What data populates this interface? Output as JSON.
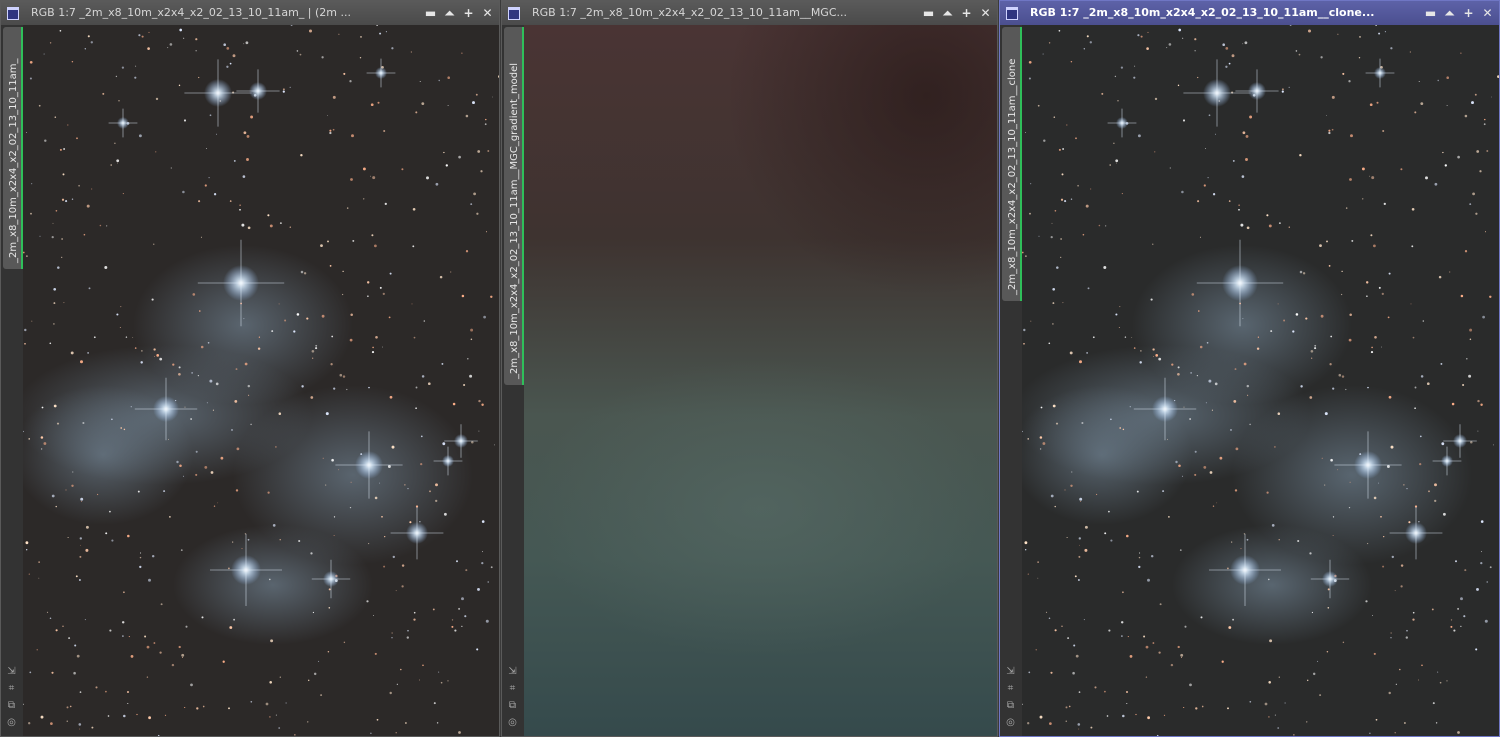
{
  "windows": [
    {
      "id": "original",
      "title": "RGB 1:7 _2m_x8_10m_x2x4_x2_02_13_10_11am_ | (2m ...",
      "tab_label": "_2m_x8_10m_x2x4_x2_02_13_10_11am_",
      "active": false,
      "image_kind": "starfield",
      "background_tint": "#2c2928"
    },
    {
      "id": "gradient-model",
      "title": "RGB 1:7 _2m_x8_10m_x2x4_x2_02_13_10_11am__MGC...",
      "tab_label": "_2m_x8_10m_x2x4_x2_02_13_10_11am__MGC_gradient_model",
      "active": false,
      "image_kind": "gradient",
      "gradient_colors": [
        "#4a3434",
        "#3e3330",
        "#4a5650",
        "#455854",
        "#354a4c"
      ]
    },
    {
      "id": "clone",
      "title": "RGB 1:7 _2m_x8_10m_x2x4_x2_02_13_10_11am__clone...",
      "tab_label": "_2m_x8_10m_x2x4_x2_02_13_10_11am__clone",
      "active": true,
      "image_kind": "starfield",
      "background_tint": "#2a2b2b"
    }
  ],
  "controls": {
    "minimize": "▬",
    "shade": "⏶",
    "maximize": "+",
    "close": "✕"
  },
  "side_icons": [
    "fit-icon",
    "zoom-icon",
    "clone-icon",
    "target-icon"
  ],
  "side_icon_glyphs": [
    "⇲",
    "⌗",
    "⧉",
    "◎"
  ]
}
